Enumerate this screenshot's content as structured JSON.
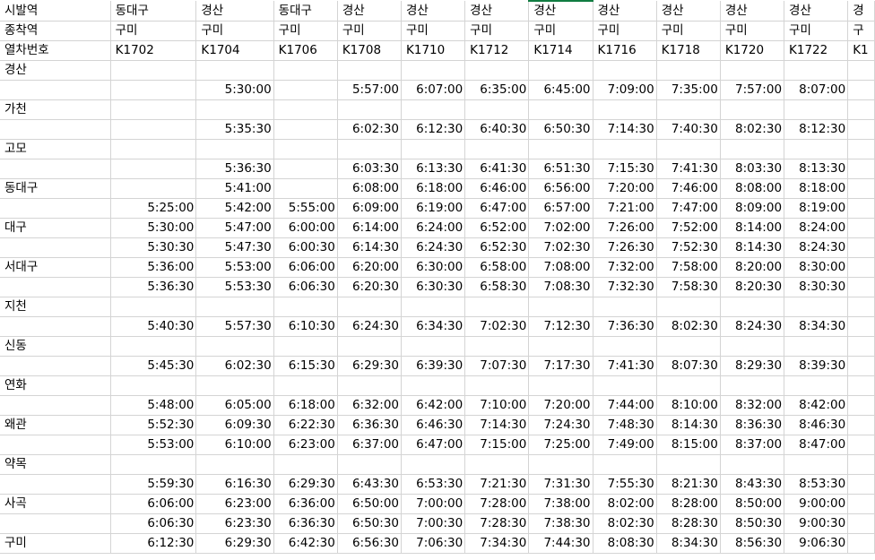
{
  "header_rows": [
    {
      "label": "시발역",
      "cells": [
        "동대구",
        "경산",
        "동대구",
        "경산",
        "경산",
        "경산",
        "경산",
        "경산",
        "경산",
        "경산",
        "경산",
        "경"
      ]
    },
    {
      "label": "종착역",
      "cells": [
        "구미",
        "구미",
        "구미",
        "구미",
        "구미",
        "구미",
        "구미",
        "구미",
        "구미",
        "구미",
        "구미",
        "구"
      ]
    },
    {
      "label": "열차번호",
      "cells": [
        "K1702",
        "K1704",
        "K1706",
        "K1708",
        "K1710",
        "K1712",
        "K1714",
        "K1716",
        "K1718",
        "K1720",
        "K1722",
        "K1"
      ]
    }
  ],
  "body_rows": [
    {
      "label": "경산",
      "cells": [
        "",
        "",
        "",
        "",
        "",
        "",
        "",
        "",
        "",
        "",
        "",
        ""
      ]
    },
    {
      "label": "",
      "cells": [
        "",
        "5:30:00",
        "",
        "5:57:00",
        "6:07:00",
        "6:35:00",
        "6:45:00",
        "7:09:00",
        "7:35:00",
        "7:57:00",
        "8:07:00",
        ""
      ]
    },
    {
      "label": "가천",
      "cells": [
        "",
        "",
        "",
        "",
        "",
        "",
        "",
        "",
        "",
        "",
        "",
        ""
      ]
    },
    {
      "label": "",
      "cells": [
        "",
        "5:35:30",
        "",
        "6:02:30",
        "6:12:30",
        "6:40:30",
        "6:50:30",
        "7:14:30",
        "7:40:30",
        "8:02:30",
        "8:12:30",
        ""
      ]
    },
    {
      "label": "고모",
      "cells": [
        "",
        "",
        "",
        "",
        "",
        "",
        "",
        "",
        "",
        "",
        "",
        ""
      ]
    },
    {
      "label": "",
      "cells": [
        "",
        "5:36:30",
        "",
        "6:03:30",
        "6:13:30",
        "6:41:30",
        "6:51:30",
        "7:15:30",
        "7:41:30",
        "8:03:30",
        "8:13:30",
        ""
      ]
    },
    {
      "label": "동대구",
      "cells": [
        "",
        "5:41:00",
        "",
        "6:08:00",
        "6:18:00",
        "6:46:00",
        "6:56:00",
        "7:20:00",
        "7:46:00",
        "8:08:00",
        "8:18:00",
        ""
      ]
    },
    {
      "label": "",
      "cells": [
        "5:25:00",
        "5:42:00",
        "5:55:00",
        "6:09:00",
        "6:19:00",
        "6:47:00",
        "6:57:00",
        "7:21:00",
        "7:47:00",
        "8:09:00",
        "8:19:00",
        ""
      ]
    },
    {
      "label": "대구",
      "cells": [
        "5:30:00",
        "5:47:00",
        "6:00:00",
        "6:14:00",
        "6:24:00",
        "6:52:00",
        "7:02:00",
        "7:26:00",
        "7:52:00",
        "8:14:00",
        "8:24:00",
        ""
      ]
    },
    {
      "label": "",
      "cells": [
        "5:30:30",
        "5:47:30",
        "6:00:30",
        "6:14:30",
        "6:24:30",
        "6:52:30",
        "7:02:30",
        "7:26:30",
        "7:52:30",
        "8:14:30",
        "8:24:30",
        ""
      ]
    },
    {
      "label": "서대구",
      "cells": [
        "5:36:00",
        "5:53:00",
        "6:06:00",
        "6:20:00",
        "6:30:00",
        "6:58:00",
        "7:08:00",
        "7:32:00",
        "7:58:00",
        "8:20:00",
        "8:30:00",
        ""
      ]
    },
    {
      "label": "",
      "cells": [
        "5:36:30",
        "5:53:30",
        "6:06:30",
        "6:20:30",
        "6:30:30",
        "6:58:30",
        "7:08:30",
        "7:32:30",
        "7:58:30",
        "8:20:30",
        "8:30:30",
        ""
      ]
    },
    {
      "label": "지천",
      "cells": [
        "",
        "",
        "",
        "",
        "",
        "",
        "",
        "",
        "",
        "",
        "",
        ""
      ]
    },
    {
      "label": "",
      "cells": [
        "5:40:30",
        "5:57:30",
        "6:10:30",
        "6:24:30",
        "6:34:30",
        "7:02:30",
        "7:12:30",
        "7:36:30",
        "8:02:30",
        "8:24:30",
        "8:34:30",
        ""
      ]
    },
    {
      "label": "신동",
      "cells": [
        "",
        "",
        "",
        "",
        "",
        "",
        "",
        "",
        "",
        "",
        "",
        ""
      ]
    },
    {
      "label": "",
      "cells": [
        "5:45:30",
        "6:02:30",
        "6:15:30",
        "6:29:30",
        "6:39:30",
        "7:07:30",
        "7:17:30",
        "7:41:30",
        "8:07:30",
        "8:29:30",
        "8:39:30",
        ""
      ]
    },
    {
      "label": "연화",
      "cells": [
        "",
        "",
        "",
        "",
        "",
        "",
        "",
        "",
        "",
        "",
        "",
        ""
      ]
    },
    {
      "label": "",
      "cells": [
        "5:48:00",
        "6:05:00",
        "6:18:00",
        "6:32:00",
        "6:42:00",
        "7:10:00",
        "7:20:00",
        "7:44:00",
        "8:10:00",
        "8:32:00",
        "8:42:00",
        ""
      ]
    },
    {
      "label": "왜관",
      "cells": [
        "5:52:30",
        "6:09:30",
        "6:22:30",
        "6:36:30",
        "6:46:30",
        "7:14:30",
        "7:24:30",
        "7:48:30",
        "8:14:30",
        "8:36:30",
        "8:46:30",
        ""
      ]
    },
    {
      "label": "",
      "cells": [
        "5:53:00",
        "6:10:00",
        "6:23:00",
        "6:37:00",
        "6:47:00",
        "7:15:00",
        "7:25:00",
        "7:49:00",
        "8:15:00",
        "8:37:00",
        "8:47:00",
        ""
      ]
    },
    {
      "label": "약목",
      "cells": [
        "",
        "",
        "",
        "",
        "",
        "",
        "",
        "",
        "",
        "",
        "",
        ""
      ]
    },
    {
      "label": "",
      "cells": [
        "5:59:30",
        "6:16:30",
        "6:29:30",
        "6:43:30",
        "6:53:30",
        "7:21:30",
        "7:31:30",
        "7:55:30",
        "8:21:30",
        "8:43:30",
        "8:53:30",
        ""
      ]
    },
    {
      "label": "사곡",
      "cells": [
        "6:06:00",
        "6:23:00",
        "6:36:00",
        "6:50:00",
        "7:00:00",
        "7:28:00",
        "7:38:00",
        "8:02:00",
        "8:28:00",
        "8:50:00",
        "9:00:00",
        ""
      ]
    },
    {
      "label": "",
      "cells": [
        "6:06:30",
        "6:23:30",
        "6:36:30",
        "6:50:30",
        "7:00:30",
        "7:28:30",
        "7:38:30",
        "8:02:30",
        "8:28:30",
        "8:50:30",
        "9:00:30",
        ""
      ]
    },
    {
      "label": "구미",
      "cells": [
        "6:12:30",
        "6:29:30",
        "6:42:30",
        "6:56:30",
        "7:06:30",
        "7:34:30",
        "7:44:30",
        "8:08:30",
        "8:34:30",
        "8:56:30",
        "9:06:30",
        ""
      ]
    }
  ]
}
